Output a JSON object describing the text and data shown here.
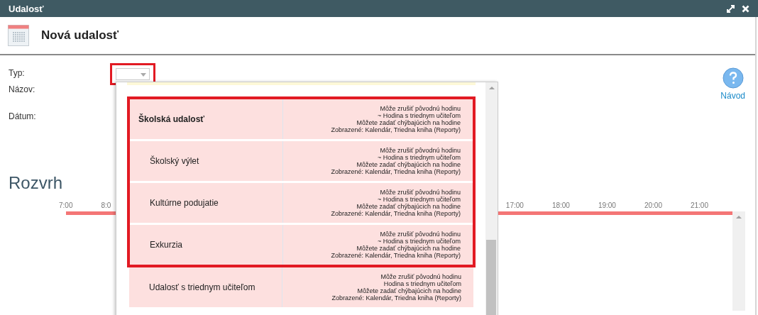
{
  "window": {
    "title": "Udalosť"
  },
  "header": {
    "title": "Nová udalosť"
  },
  "form": {
    "fields": [
      {
        "label": "Typ:",
        "kind": "select",
        "highlighted": true
      },
      {
        "label": "Názov:",
        "kind": "text"
      },
      {
        "label": "Dátum:",
        "kind": "text"
      }
    ]
  },
  "help": {
    "label": "Návod"
  },
  "schedule": {
    "title": "Rozvrh",
    "hours_left": [
      "7:00",
      "8:0"
    ],
    "hours_right": [
      "17:00",
      "18:00",
      "19:00",
      "20:00",
      "21:00"
    ]
  },
  "dropdown": {
    "highlighted_options": [
      {
        "name": "Školská udalosť",
        "kind": "group",
        "details": [
          "Môže zrušiť pôvodnú hodinu",
          "~ Hodina s triednym učiteľom",
          "Môžete zadať chýbajúcich na hodine",
          "Zobrazené: Kalendár, Triedna kniha (Reporty)"
        ]
      },
      {
        "name": "Školský výlet",
        "kind": "item",
        "details": [
          "Môže zrušiť pôvodnú hodinu",
          "~ Hodina s triednym učiteľom",
          "Môžete zadať chýbajúcich na hodine",
          "Zobrazené: Kalendár, Triedna kniha (Reporty)"
        ]
      },
      {
        "name": "Kultúrne podujatie",
        "kind": "item",
        "details": [
          "Môže zrušiť pôvodnú hodinu",
          "~ Hodina s triednym učiteľom",
          "Môžete zadať chýbajúcich na hodine",
          "Zobrazené: Kalendár, Triedna kniha (Reporty)"
        ]
      },
      {
        "name": "Exkurzia",
        "kind": "item",
        "details": [
          "Môže zrušiť pôvodnú hodinu",
          "~ Hodina s triednym učiteľom",
          "Môžete zadať chýbajúcich na hodine",
          "Zobrazené: Kalendár, Triedna kniha (Reporty)"
        ]
      }
    ],
    "other_options": [
      {
        "name": "Udalosť s triednym učiteľom",
        "kind": "item",
        "details": [
          "Môže zrušiť pôvodnú hodinu",
          "Hodina s triednym učiteľom",
          "Môžete zadať chýbajúcich na hodine",
          "Zobrazené: Kalendár, Triedna kniha (Reporty)"
        ]
      }
    ]
  }
}
